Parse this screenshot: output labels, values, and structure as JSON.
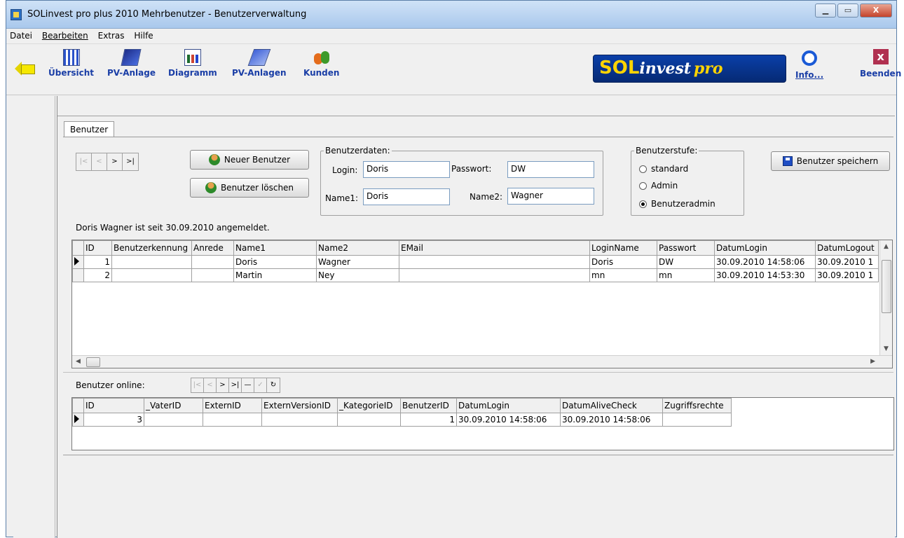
{
  "window": {
    "title": "SOLinvest pro plus 2010 Mehrbenutzer - Benutzerverwaltung",
    "controls": [
      "▁",
      "▭",
      "X"
    ]
  },
  "menu": [
    {
      "label": "Datei"
    },
    {
      "label": "Bearbeiten"
    },
    {
      "label": "Extras"
    },
    {
      "label": "Hilfe"
    }
  ],
  "toolbar": {
    "buttons": [
      {
        "label": "Übersicht",
        "icon": "overview-grid-icon"
      },
      {
        "label": "PV-Anlage",
        "icon": "solar-panel-icon"
      },
      {
        "label": "Diagramm",
        "icon": "bar-chart-icon"
      },
      {
        "label": "PV-Anlagen",
        "icon": "solar-panels-icon"
      },
      {
        "label": "Kunden",
        "icon": "people-icon"
      }
    ],
    "logo": {
      "sol": "SOL",
      "invest": "invest",
      "pro": "pro"
    },
    "info_label": "Info...",
    "quit_label": "Beenden",
    "quit_glyph": "x"
  },
  "tab": {
    "label": "Benutzer"
  },
  "navigator_top": [
    "|<",
    "<",
    ">",
    ">|"
  ],
  "buttons": {
    "new_user": "Neuer Benutzer",
    "delete_user": "Benutzer löschen",
    "save_user": "Benutzer speichern"
  },
  "userdata": {
    "legend": "Benutzerdaten:",
    "login_label": "Login:",
    "login_value": "Doris",
    "password_label": "Passwort:",
    "password_value": "DW",
    "name1_label": "Name1:",
    "name1_value": "Doris",
    "name2_label": "Name2:",
    "name2_value": "Wagner"
  },
  "userlevel": {
    "legend": "Benutzerstufe:",
    "options": [
      "standard",
      "Admin",
      "Benutzeradmin"
    ],
    "selected": "Benutzeradmin"
  },
  "status_message": "Doris Wagner ist seit 30.09.2010 angemeldet.",
  "users_table": {
    "columns": [
      "ID",
      "Benutzerkennung",
      "Anrede",
      "Name1",
      "Name2",
      "EMail",
      "LoginName",
      "Passwort",
      "DatumLogin",
      "DatumLogout"
    ],
    "rows": [
      {
        "current": true,
        "ID": "1",
        "Benutzerkennung": "",
        "Anrede": "",
        "Name1": "Doris",
        "Name2": "Wagner",
        "EMail": "",
        "LoginName": "Doris",
        "Passwort": "DW",
        "DatumLogin": "30.09.2010 14:58:06",
        "DatumLogout": "30.09.2010 1"
      },
      {
        "current": false,
        "ID": "2",
        "Benutzerkennung": "",
        "Anrede": "",
        "Name1": "Martin",
        "Name2": "Ney",
        "EMail": "",
        "LoginName": "mn",
        "Passwort": "mn",
        "DatumLogin": "30.09.2010 14:53:30",
        "DatumLogout": "30.09.2010 1"
      }
    ]
  },
  "online": {
    "label": "Benutzer online:",
    "navigator": [
      "|<",
      "<",
      ">",
      ">|",
      "—",
      "✓",
      "↻"
    ]
  },
  "online_table": {
    "columns": [
      "ID",
      "_VaterID",
      "ExternID",
      "ExternVersionID",
      "_KategorieID",
      "BenutzerID",
      "DatumLogin",
      "DatumAliveCheck",
      "Zugriffsrechte"
    ],
    "rows": [
      {
        "current": true,
        "ID": "3",
        "_VaterID": "",
        "ExternID": "",
        "ExternVersionID": "",
        "_KategorieID": "",
        "BenutzerID": "1",
        "DatumLogin": "30.09.2010 14:58:06",
        "DatumAliveCheck": "30.09.2010 14:58:06",
        "Zugriffsrechte": ""
      }
    ]
  }
}
